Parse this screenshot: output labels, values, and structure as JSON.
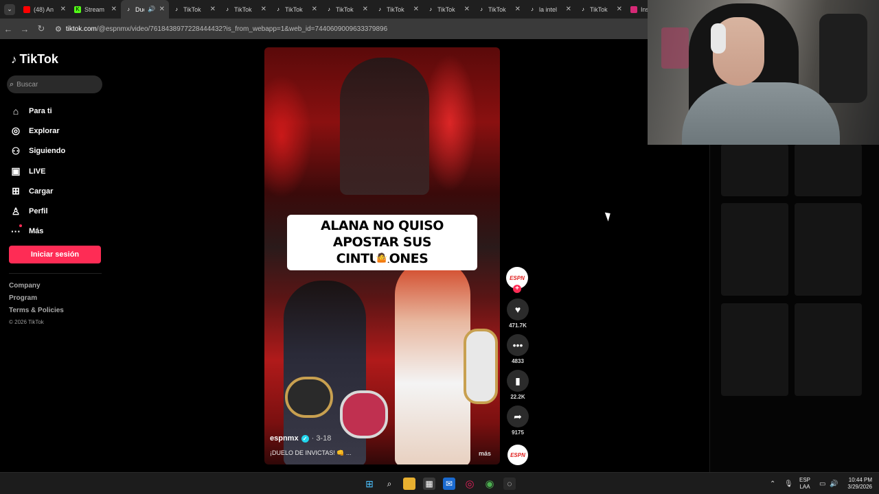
{
  "browser": {
    "tabs": [
      {
        "title": "(48) An",
        "icon": "youtube-icon",
        "color": "#ff0000"
      },
      {
        "title": "Stream",
        "icon": "kick-icon",
        "color": "#53fc18"
      },
      {
        "title": "Due",
        "icon": "tiktok-icon",
        "active": true
      },
      {
        "title": "TikTok",
        "icon": "tiktok-icon"
      },
      {
        "title": "TikTok",
        "icon": "tiktok-icon"
      },
      {
        "title": "TikTok",
        "icon": "tiktok-icon"
      },
      {
        "title": "TikTok",
        "icon": "tiktok-icon"
      },
      {
        "title": "TikTok",
        "icon": "tiktok-icon"
      },
      {
        "title": "TikTok",
        "icon": "tiktok-icon"
      },
      {
        "title": "TikTok",
        "icon": "tiktok-icon"
      },
      {
        "title": "la intel",
        "icon": "tiktok-icon"
      },
      {
        "title": "TikTok",
        "icon": "tiktok-icon"
      },
      {
        "title": "Ins",
        "icon": "instagram-icon",
        "color": "#d62976"
      }
    ],
    "url_site": "tiktok.com",
    "url_path": "/@espnmx/video/7618438977228444432?is_from_webapp=1&web_id=7440609009633379896"
  },
  "tiktok": {
    "logo": "TikTok",
    "search_placeholder": "Buscar",
    "nav": [
      {
        "label": "Para ti",
        "icon": "home-icon"
      },
      {
        "label": "Explorar",
        "icon": "compass-icon"
      },
      {
        "label": "Siguiendo",
        "icon": "following-icon"
      },
      {
        "label": "LIVE",
        "icon": "live-icon"
      },
      {
        "label": "Cargar",
        "icon": "upload-icon"
      },
      {
        "label": "Perfil",
        "icon": "profile-icon"
      },
      {
        "label": "Más",
        "icon": "more-icon"
      }
    ],
    "login_label": "Iniciar sesión",
    "footer_links": [
      "Company",
      "Program",
      "Terms & Policies"
    ],
    "copyright": "© 2026 TikTok"
  },
  "video": {
    "caption_line1": "ALANA NO QUISO",
    "caption_line2": "APOSTAR SUS CINTURONES",
    "username": "espnmx",
    "date": "3-18",
    "description": "¡DUELO DE INVICTAS! 👊 ...",
    "more_label": "más",
    "author_logo": "ESPN",
    "likes": "471.7K",
    "comments": "4833",
    "saves": "22.2K",
    "shares": "9175"
  },
  "taskbar": {
    "lang_line1": "ESP",
    "lang_line2": "LAA",
    "time": "10:44 PM",
    "date": "3/29/2026"
  }
}
